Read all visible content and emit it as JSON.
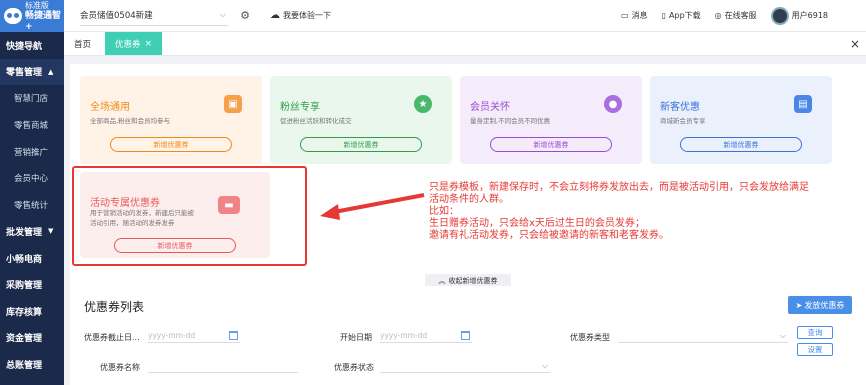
{
  "app": {
    "logo_line1": "标准版",
    "logo_line2": "畅捷通智+"
  },
  "sidebar": {
    "items": [
      {
        "label": "快捷导航",
        "type": "top"
      },
      {
        "label": "零售管理",
        "type": "section",
        "caret": "▲"
      },
      {
        "label": "智慧门店",
        "type": "sub"
      },
      {
        "label": "零售商城",
        "type": "sub"
      },
      {
        "label": "营销推广",
        "type": "sub"
      },
      {
        "label": "会员中心",
        "type": "sub"
      },
      {
        "label": "零售统计",
        "type": "sub"
      },
      {
        "label": "批发管理",
        "type": "top",
        "caret": "▼"
      },
      {
        "label": "小畅电商",
        "type": "top"
      },
      {
        "label": "采购管理",
        "type": "top"
      },
      {
        "label": "库存核算",
        "type": "top"
      },
      {
        "label": "资金管理",
        "type": "top"
      },
      {
        "label": "总账管理",
        "type": "top"
      }
    ]
  },
  "topbar": {
    "store": "会员储值0504新建",
    "experience": "我要体验一下",
    "messages": "消息",
    "app_download": "App下载",
    "online_service": "在线客服",
    "user": "用户6918"
  },
  "tabs": [
    {
      "label": "首页"
    },
    {
      "label": "优惠券"
    }
  ],
  "cards": [
    {
      "title": "全场通用",
      "desc": "全部商品,粉丝和会员均参与",
      "button": "新增优惠券",
      "icon": "coupon-icon"
    },
    {
      "title": "粉丝专享",
      "desc": "促进粉丝活跃和转化成交",
      "button": "新增优惠券",
      "icon": "star-icon"
    },
    {
      "title": "会员关怀",
      "desc": "量身定制,不同会员不同优惠",
      "button": "新增优惠券",
      "icon": "member-icon"
    },
    {
      "title": "新客优惠",
      "desc": "商城新会员专享",
      "button": "新增优惠券",
      "icon": "card-icon"
    },
    {
      "title": "活动专属优惠券",
      "desc1": "用于营销活动的发券，新建后只能被",
      "desc2": "活动引用，随活动的发券发券",
      "button": "新增优惠券",
      "icon": "ticket-icon"
    }
  ],
  "annotation": {
    "lines": [
      "只是券模板，新建保存时，不会立刻将券发放出去，而是被活动引用，只会发放给满足",
      "活动条件的人群。",
      "比如：",
      "生日赠券活动，只会给x天后过生日的会员发券；",
      "邀请有礼活动发券，只会给被邀请的新客和老客发券。"
    ]
  },
  "collapse_label": "收起新增优惠券",
  "list": {
    "title": "优惠券列表",
    "issue_button": "发放优惠券",
    "filters": {
      "deadline_label": "优惠券截止日...",
      "deadline_placeholder": "yyyy-mm-dd",
      "start_label": "开始日期",
      "start_placeholder": "yyyy-mm-dd",
      "type_label": "优惠券类型",
      "name_label": "优惠券名称",
      "status_label": "优惠券状态"
    },
    "query_button": "查询",
    "settings_button": "设置"
  },
  "colors": {
    "sidebar": "#1b2a4a",
    "active_tab": "#3ecfb4",
    "annotation": "#e53935",
    "primary": "#4a8fe7"
  }
}
